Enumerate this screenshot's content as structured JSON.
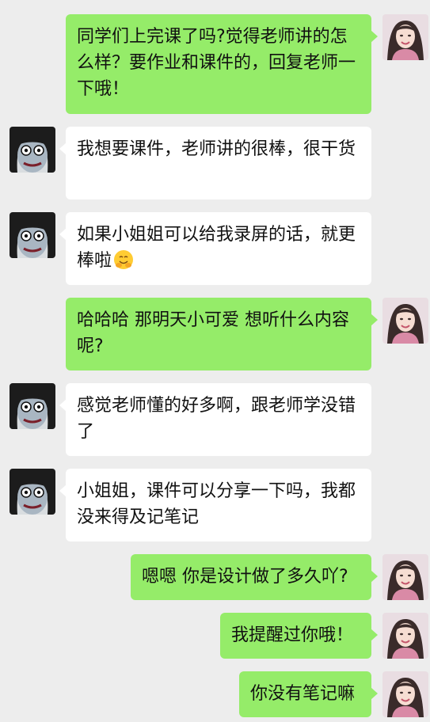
{
  "messages": [
    {
      "sender": "self",
      "text": "同学们上完课了吗?觉得老师讲的怎么样？要作业和课件的，回复老师一下哦！"
    },
    {
      "sender": "other",
      "text": "我想要课件，老师讲的很棒，很干货"
    },
    {
      "sender": "other",
      "text": "如果小姐姐可以给我录屏的话，就更棒啦",
      "emoji": "hugging-face-emoji"
    },
    {
      "sender": "self",
      "text": "哈哈哈  那明天小可爱  想听什么内容呢?"
    },
    {
      "sender": "other",
      "text": "感觉老师懂的好多啊，跟老师学没错了"
    },
    {
      "sender": "other",
      "text": "小姐姐，课件可以分享一下吗，我都没来得及记笔记"
    },
    {
      "sender": "self",
      "text": "嗯嗯 你是设计做了多久吖?"
    },
    {
      "sender": "self",
      "text": "我提醒过你哦！"
    },
    {
      "sender": "self",
      "text": "你没有笔记嘛"
    }
  ],
  "colors": {
    "background": "#ededed",
    "outgoing_bubble": "#95ec69",
    "incoming_bubble": "#ffffff"
  },
  "avatars": {
    "self": "woman-portrait-avatar",
    "other": "ghost-cartoon-avatar"
  }
}
